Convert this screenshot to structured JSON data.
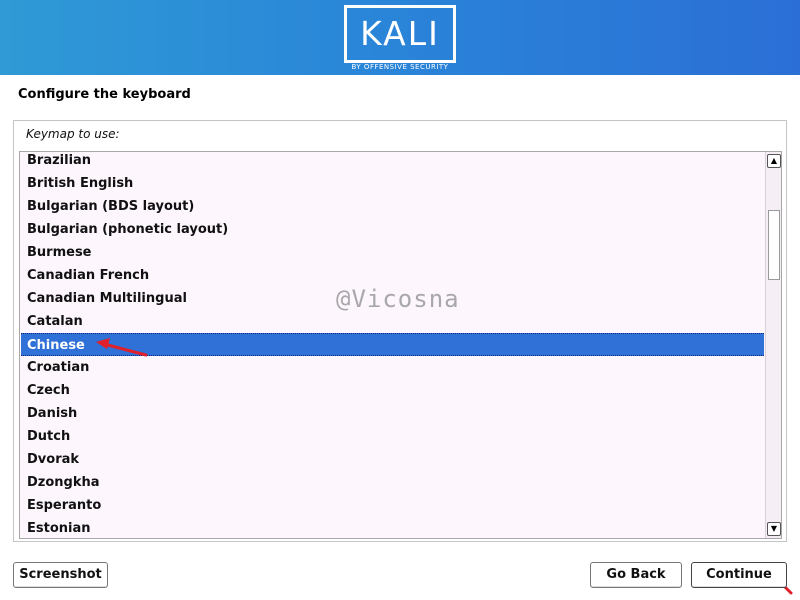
{
  "header": {
    "logo_text": "KALI",
    "logo_subtitle": "BY OFFENSIVE SECURITY",
    "brand_colors": [
      "#2f9ad6",
      "#2b6fd6"
    ]
  },
  "page": {
    "title": "Configure the keyboard"
  },
  "keymap": {
    "label": "Keymap to use:",
    "items": [
      "Brazilian",
      "British English",
      "Bulgarian (BDS layout)",
      "Bulgarian (phonetic layout)",
      "Burmese",
      "Canadian French",
      "Canadian Multilingual",
      "Catalan",
      "Chinese",
      "Croatian",
      "Czech",
      "Danish",
      "Dutch",
      "Dvorak",
      "Dzongkha",
      "Esperanto",
      "Estonian"
    ],
    "selected": "Chinese",
    "selection_color": "#2f71d6"
  },
  "watermark": "@Vicosna",
  "buttons": {
    "screenshot": "Screenshot",
    "go_back": "Go Back",
    "continue": "Continue"
  },
  "annotation_color": "#e0202a"
}
